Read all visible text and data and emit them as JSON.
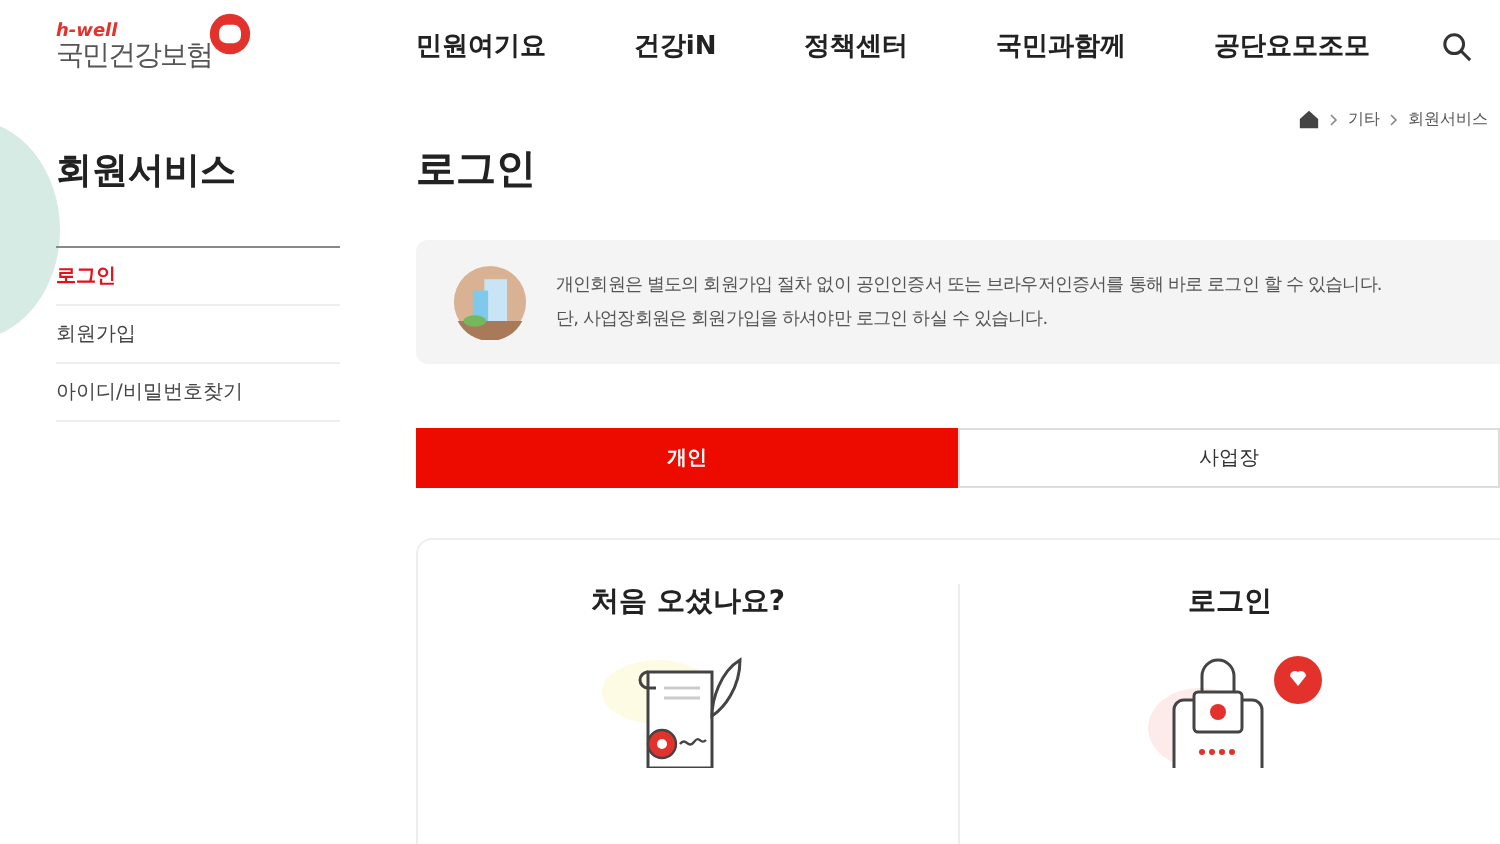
{
  "logo": {
    "tagline": "h-well",
    "name": "국민건강보험"
  },
  "nav": [
    {
      "label": "민원여기요"
    },
    {
      "label": "건강iN"
    },
    {
      "label": "정책센터"
    },
    {
      "label": "국민과함께"
    },
    {
      "label": "공단요모조모"
    }
  ],
  "breadcrumb": [
    "기타",
    "회원서비스"
  ],
  "sidebar": {
    "title": "회원서비스",
    "items": [
      {
        "label": "로그인",
        "selected": true
      },
      {
        "label": "회원가입",
        "selected": false
      },
      {
        "label": "아이디/비밀번호찾기",
        "selected": false
      }
    ]
  },
  "page_title": "로그인",
  "notice": [
    "개인회원은 별도의 회원가입 절차 없이 공인인증서 또는 브라우저인증서를 통해 바로 로그인 할 수 있습니다.",
    "단, 사업장회원은 회원가입을 하셔야만 로그인 하실 수 있습니다."
  ],
  "tabs": [
    {
      "label": "개인",
      "selected": true
    },
    {
      "label": "사업장",
      "selected": false
    }
  ],
  "panels": [
    {
      "kind": "signup",
      "title": "처음 오셨나요?"
    },
    {
      "kind": "login",
      "title": "로그인"
    }
  ]
}
